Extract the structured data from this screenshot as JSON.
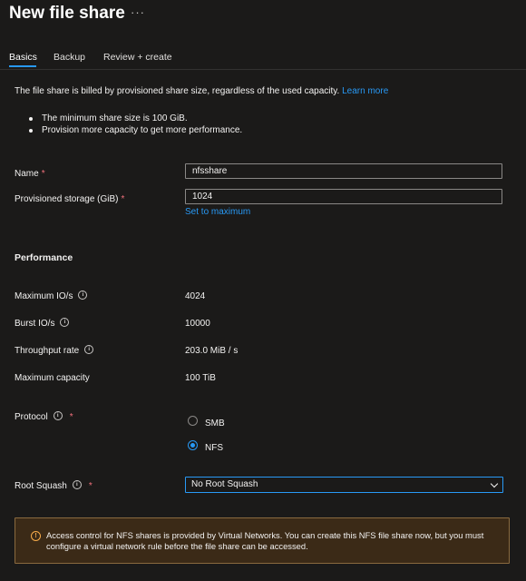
{
  "header": {
    "title": "New file share",
    "more_label": "···"
  },
  "tabs": [
    {
      "label": "Basics",
      "active": true
    },
    {
      "label": "Backup",
      "active": false
    },
    {
      "label": "Review + create",
      "active": false
    }
  ],
  "intro": {
    "text": "The file share is billed by provisioned share size, regardless of the used capacity.",
    "link": "Learn more"
  },
  "bullets": [
    "The minimum share size is 100 GiB.",
    "Provision more capacity to get more performance."
  ],
  "form": {
    "name_label": "Name",
    "name_value": "nfsshare",
    "storage_label": "Provisioned storage (GiB)",
    "storage_value": "1024",
    "set_max_link": "Set to maximum",
    "required_mark": "*"
  },
  "performance": {
    "heading": "Performance",
    "rows": [
      {
        "label": "Maximum IO/s",
        "value": "4024",
        "info": true
      },
      {
        "label": "Burst IO/s",
        "value": "10000",
        "info": true
      },
      {
        "label": "Throughput rate",
        "value": "203.0 MiB / s",
        "info": true
      },
      {
        "label": "Maximum capacity",
        "value": "100 TiB",
        "info": false
      }
    ]
  },
  "protocol": {
    "label": "Protocol",
    "options": [
      {
        "label": "SMB",
        "selected": false
      },
      {
        "label": "NFS",
        "selected": true
      }
    ]
  },
  "root_squash": {
    "label": "Root Squash",
    "selected": "No Root Squash"
  },
  "warning": {
    "icon": "warning-circle-icon",
    "text": "Access control for NFS shares is provided by Virtual Networks. You can create this NFS file share now, but you must configure a virtual network rule before the file share can be accessed."
  },
  "colors": {
    "background": "#1b1a19",
    "accent": "#2899f5",
    "required": "#f1707b",
    "warning_bg": "#3b2a17",
    "warning_icon": "#f7ab4a"
  }
}
